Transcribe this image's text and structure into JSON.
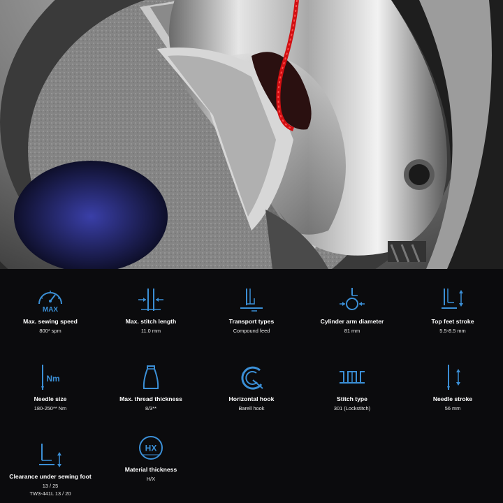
{
  "colors": {
    "background": "#0b0b0d",
    "icon": "#3b8fd6",
    "text": "#ffffff",
    "thread": "#d10f12"
  },
  "hero": {
    "image": "close-up photo of sewing machine rotary hook with red thread"
  },
  "specs": {
    "row1": [
      {
        "icon": "speedometer-max-icon",
        "icon_text": "MAX",
        "label": "Max. sewing speed",
        "value": "800* spm"
      },
      {
        "icon": "stitch-length-icon",
        "label": "Max. stitch length",
        "value": "11.0 mm"
      },
      {
        "icon": "transport-types-icon",
        "label": "Transport types",
        "value": "Compound feed"
      },
      {
        "icon": "cylinder-arm-icon",
        "label": "Cylinder arm diameter",
        "value": "81 mm"
      },
      {
        "icon": "top-feet-stroke-icon",
        "label": "Top feet stroke",
        "value": "5.5-8.5 mm"
      }
    ],
    "row2": [
      {
        "icon": "needle-size-icon",
        "icon_text": "Nm",
        "label": "Needle size",
        "value": "180-250** Nm"
      },
      {
        "icon": "thread-spool-icon",
        "label": "Max. thread thickness",
        "value": "8/3**"
      },
      {
        "icon": "horizontal-hook-icon",
        "label": "Horizontal hook",
        "value": "Barell hook"
      },
      {
        "icon": "stitch-type-icon",
        "label": "Stitch type",
        "value": "301 (Lockstitch)"
      },
      {
        "icon": "needle-stroke-icon",
        "label": "Needle stroke",
        "value": "56 mm"
      }
    ],
    "row3": [
      {
        "icon": "clearance-foot-icon",
        "label": "Clearance under sewing foot",
        "value": "13 / 25",
        "value2": "TW3-441L  13 / 20"
      },
      {
        "icon": "material-thickness-icon",
        "icon_text": "HX",
        "label": "Material thickness",
        "value": "H/X"
      }
    ]
  }
}
